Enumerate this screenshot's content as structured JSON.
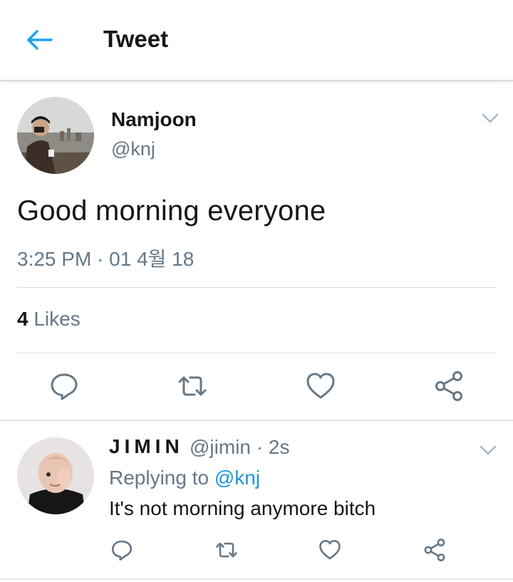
{
  "header": {
    "title": "Tweet",
    "back_icon": "arrow-left-icon",
    "accent": "#1da1f2"
  },
  "tweet": {
    "author_name": "Namjoon",
    "handle": "@knj",
    "text": "Good morning everyone",
    "timestamp": "3:25 PM · 01 4월 18",
    "likes_count": "4",
    "likes_label": "Likes",
    "actions": [
      "reply-icon",
      "retweet-icon",
      "like-icon",
      "share-icon"
    ]
  },
  "reply": {
    "author_name": "JIMIN",
    "handle": "@jimin",
    "time": "· 2s",
    "replying_prefix": "Replying to",
    "replying_mention": "@knj",
    "text": "It's not morning anymore bitch",
    "actions": [
      "reply-icon",
      "retweet-icon",
      "like-icon",
      "share-icon"
    ]
  },
  "colors": {
    "text": "#14171a",
    "secondary": "#657786",
    "link": "#1b95e0",
    "divider": "#d8dde1"
  }
}
